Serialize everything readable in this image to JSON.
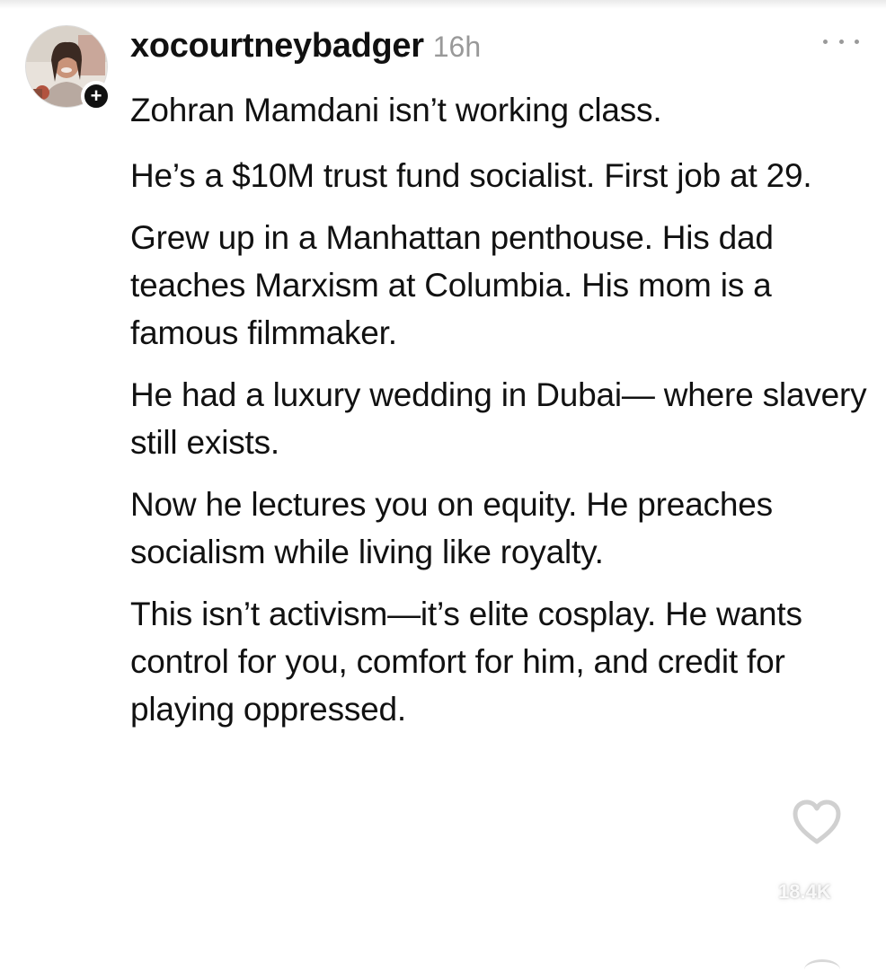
{
  "post": {
    "username": "xocourtneybadger",
    "timestamp": "16h",
    "follow_badge": "+",
    "avatar_icon": "profile-photo",
    "more_icon": "more-horizontal-icon",
    "paragraphs": [
      "Zohran Mamdani isn’t working class.",
      "He’s a $10M trust fund socialist. First job at 29.",
      "Grew up in a Manhattan penthouse. His dad teaches Marxism at Columbia. His mom is a famous filmmaker.",
      "He had a luxury wedding in Dubai— where slavery still exists.",
      "Now he lectures you on equity. He preaches socialism while living like royalty.",
      "This isn’t activism—it’s elite cosplay. He wants control for you, comfort for him, and credit for playing oppressed."
    ]
  },
  "overlay": {
    "like_icon": "heart-outline-icon",
    "like_count": "18.4K"
  }
}
